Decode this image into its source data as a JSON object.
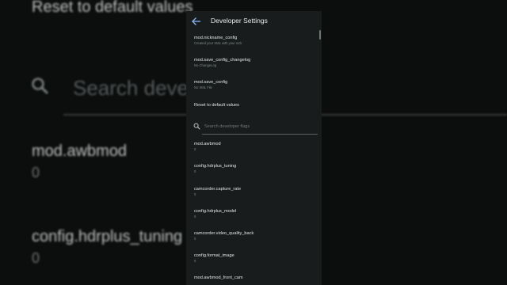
{
  "background": {
    "reset_text": "Reset to default values",
    "search_text": "Search develo",
    "item1_label": "mod.awbmod",
    "item1_value": "0",
    "item2_label": "config.hdrplus_tuning",
    "item2_value": "0"
  },
  "header": {
    "title": "Developer Settings"
  },
  "top_items": [
    {
      "label": "mod.nickname_config",
      "value": "Created your XML with your nick"
    },
    {
      "label": "mod.save_config_changelog",
      "value": "No ChangeLog"
    },
    {
      "label": "mod.save_config",
      "value": "No XML File"
    }
  ],
  "reset": {
    "label": "Reset to default values"
  },
  "search": {
    "placeholder": "Search developer flags"
  },
  "flags": [
    {
      "label": "mod.awbmod",
      "value": "0"
    },
    {
      "label": "config.hdrplus_tuning",
      "value": "0"
    },
    {
      "label": "camcorder.capture_rate",
      "value": "0"
    },
    {
      "label": "config.hdrplus_model",
      "value": "0"
    },
    {
      "label": "camcorder.video_quality_back",
      "value": "0"
    },
    {
      "label": "config.format_image",
      "value": "0"
    },
    {
      "label": "mod.awbmod_front_cam",
      "value": ""
    }
  ],
  "colors": {
    "accent": "#8ab4f8",
    "panel": "#191c1c",
    "text": "#dfe5e4",
    "subtext": "#7f8988"
  },
  "icons": {
    "back": "arrow-back-icon",
    "search": "search-icon"
  }
}
